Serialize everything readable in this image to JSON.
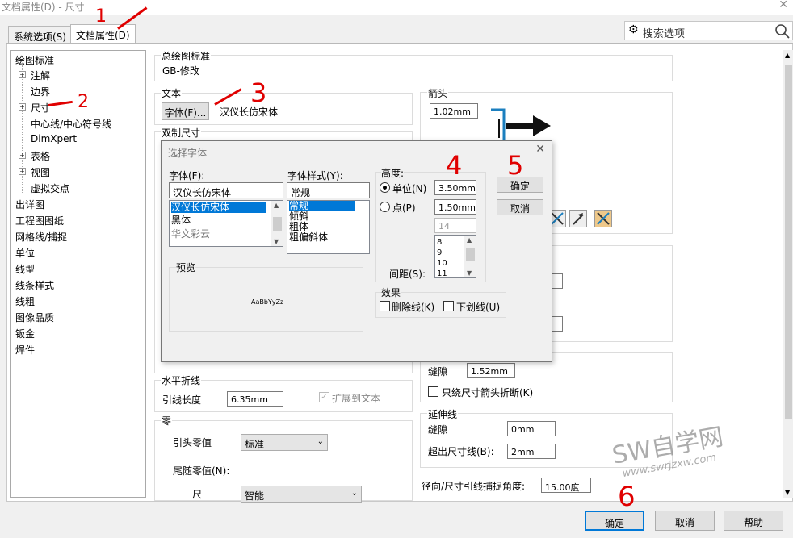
{
  "window": {
    "title": "文档属性(D) - 尺寸"
  },
  "tabs": [
    {
      "label": "系统选项(S)"
    },
    {
      "label": "文档属性(D)"
    }
  ],
  "search": {
    "placeholder": "搜索选项"
  },
  "tree": {
    "items": [
      {
        "label": "绘图标准"
      },
      {
        "label": "注解"
      },
      {
        "label": "边界"
      },
      {
        "label": "尺寸"
      },
      {
        "label": "中心线/中心符号线"
      },
      {
        "label": "DimXpert"
      },
      {
        "label": "表格"
      },
      {
        "label": "视图"
      },
      {
        "label": "虚拟交点"
      },
      {
        "label": "出详图"
      },
      {
        "label": "工程图图纸"
      },
      {
        "label": "网格线/捕捉"
      },
      {
        "label": "单位"
      },
      {
        "label": "线型"
      },
      {
        "label": "线条样式"
      },
      {
        "label": "线粗"
      },
      {
        "label": "图像品质"
      },
      {
        "label": "钣金"
      },
      {
        "label": "焊件"
      }
    ]
  },
  "main": {
    "overall_standard": {
      "title": "总绘图标准",
      "value": "GB-修改"
    },
    "text": {
      "title": "文本",
      "font_button": "字体(F)...",
      "font_name": "汉仪长仿宋体"
    },
    "dual_dim": {
      "title": "双制尺寸"
    },
    "arrows": {
      "title": "箭头",
      "size": "1.02mm"
    },
    "horizontal_fold": {
      "title": "水平折线",
      "leader_length_label": "引线长度",
      "leader_length": "6.35mm",
      "extend_to_text": "扩展到文本"
    },
    "zeros": {
      "title": "零",
      "leading_label": "引头零值",
      "leading_value": "标准",
      "trailing_label": "尾随零值(N):",
      "dim_label": "尺",
      "dim_value": "智能"
    },
    "gap": {
      "label": "缝隙",
      "value": "1.52mm",
      "only_arrow_break": "只绕尺寸箭头折断(K)"
    },
    "extension": {
      "title": "延伸线",
      "gap_label": "缝隙",
      "gap_value": "0mm",
      "beyond_label": "超出尺寸线(B):",
      "beyond_value": "2mm"
    },
    "snap_angle": {
      "label": "径向/尺寸引线捕捉角度:",
      "value": "15.00度"
    }
  },
  "dialog": {
    "title": "选择字体",
    "font_label": "字体(F):",
    "font_value": "汉仪长仿宋体",
    "fonts": [
      "汉仪长仿宋体",
      "黑体",
      "华文彩云"
    ],
    "style_label": "字体样式(Y):",
    "style_value": "常规",
    "styles": [
      "常规",
      "倾斜",
      "粗体",
      "粗偏斜体"
    ],
    "height_title": "高度:",
    "unit_label": "单位(N)",
    "unit_value": "3.50mm",
    "point_label": "点(P)",
    "point_value": "1.50mm",
    "point_size": "14",
    "sizes": [
      "8",
      "9",
      "10",
      "11"
    ],
    "spacing_label": "间距(S):",
    "preview_title": "预览",
    "preview_text": "AaBbYyZz",
    "effects_title": "效果",
    "strike_label": "删除线(K)",
    "underline_label": "下划线(U)",
    "ok": "确定",
    "cancel": "取消"
  },
  "buttons": {
    "ok": "确定",
    "cancel": "取消",
    "help": "帮助"
  },
  "annotations": [
    "1",
    "2",
    "3",
    "4",
    "5",
    "6"
  ],
  "watermark": {
    "main": "SW自学网",
    "url": "www.swrjzxw.com"
  }
}
